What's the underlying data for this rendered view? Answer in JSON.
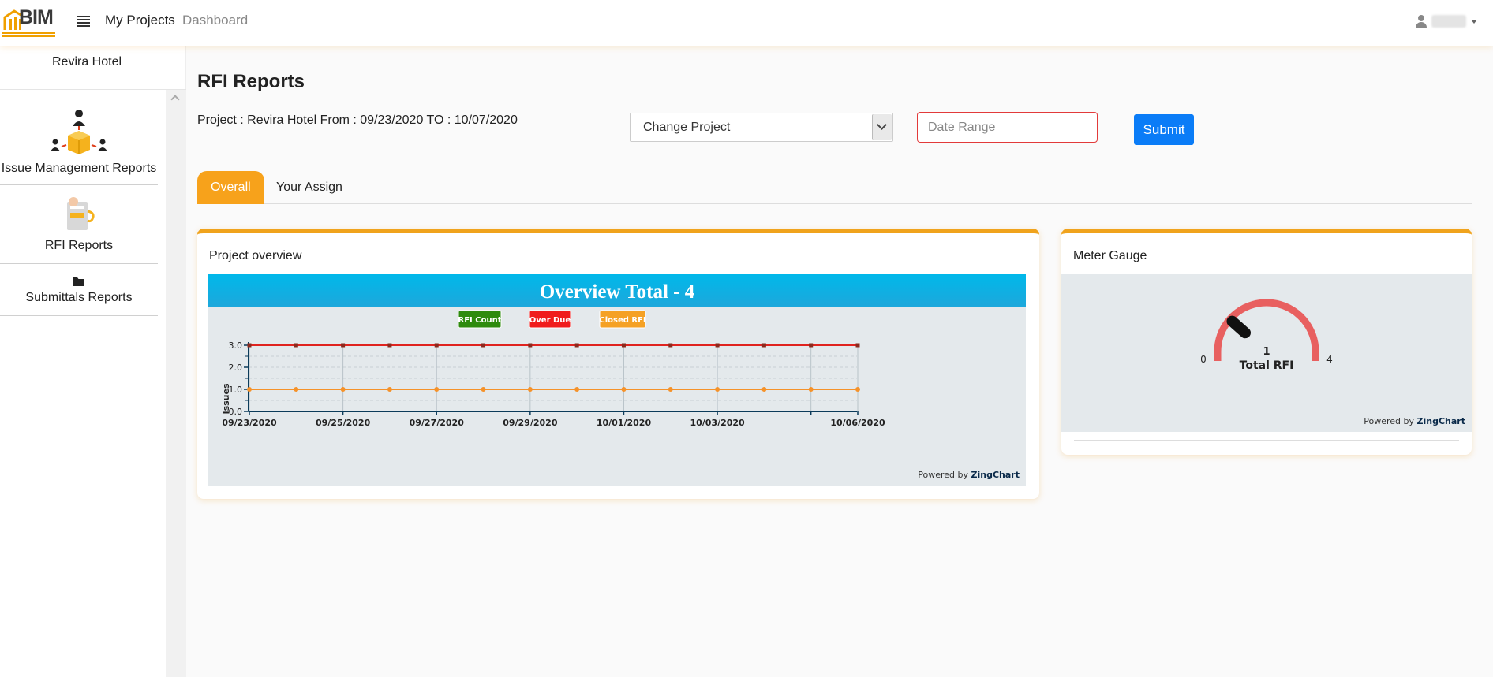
{
  "header": {
    "logo_text": "BIM",
    "nav_projects": "My Projects",
    "nav_dashboard": "Dashboard"
  },
  "sidebar": {
    "title": "Revira Hotel",
    "items": [
      {
        "label": "Issue Management Reports",
        "icon": "people-box-icon"
      },
      {
        "label": "RFI Reports",
        "icon": "rfi-report-icon"
      },
      {
        "label": "Submittals Reports",
        "icon": "folder-icon"
      }
    ]
  },
  "main": {
    "title": "RFI Reports",
    "project_info": "Project : Revira Hotel From : 09/23/2020 TO : 10/07/2020",
    "project_select": "Change Project",
    "date_placeholder": "Date Range",
    "submit_label": "Submit",
    "tabs": [
      {
        "label": "Overall",
        "active": true
      },
      {
        "label": "Your Assign",
        "active": false
      }
    ]
  },
  "overview_card": {
    "title": "Project overview",
    "powered_by_prefix": "Powered by ",
    "powered_by_brand": "ZingChart"
  },
  "gauge_card": {
    "title": "Meter Gauge",
    "powered_by_prefix": "Powered by ",
    "powered_by_brand": "ZingChart"
  },
  "chart_data": [
    {
      "type": "line",
      "title": "Overview Total - 4",
      "ylabel": "Issues",
      "xlabel": "",
      "ylim": [
        0,
        3
      ],
      "yticks": [
        "0.0",
        "1.0",
        "2.0",
        "3.0"
      ],
      "x_tick_labels": [
        "09/23/2020",
        "09/25/2020",
        "09/27/2020",
        "09/29/2020",
        "10/01/2020",
        "10/03/2020",
        "10/06/2020"
      ],
      "x": [
        "09/23/2020",
        "09/24/2020",
        "09/25/2020",
        "09/26/2020",
        "09/27/2020",
        "09/28/2020",
        "09/29/2020",
        "09/30/2020",
        "10/01/2020",
        "10/02/2020",
        "10/03/2020",
        "10/04/2020",
        "10/05/2020",
        "10/06/2020"
      ],
      "legend": [
        {
          "label": "RFI Count",
          "color": "#2e8b0e"
        },
        {
          "label": "Over Due",
          "color": "#f01c1c"
        },
        {
          "label": "Closed RFI",
          "color": "#f5a124"
        }
      ],
      "legend_position": "top",
      "grid": true,
      "series": [
        {
          "color": "#e0231f",
          "values": [
            3,
            3,
            3,
            3,
            3,
            3,
            3,
            3,
            3,
            3,
            3,
            3,
            3,
            3
          ]
        },
        {
          "color": "#f5922a",
          "values": [
            1,
            1,
            1,
            1,
            1,
            1,
            1,
            1,
            1,
            1,
            1,
            1,
            1,
            1
          ]
        }
      ]
    },
    {
      "type": "gauge",
      "min": 0,
      "max": 4,
      "value": 1,
      "min_label": "0",
      "max_label": "4",
      "value_label": "1",
      "label": "Total RFI",
      "arc_color": "#e86060"
    }
  ]
}
